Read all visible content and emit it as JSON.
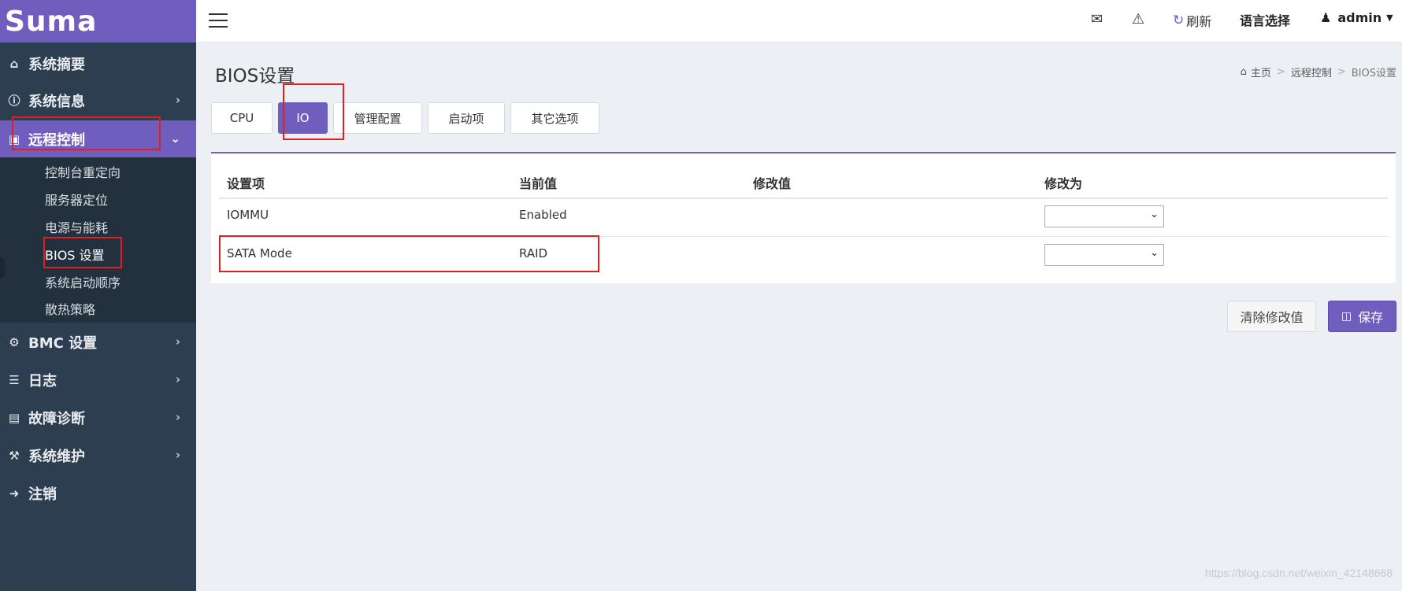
{
  "brand": {
    "logo_text": "Suma",
    "accent_color": "#6f5ebd"
  },
  "sidebar": {
    "items": [
      {
        "label": "系统摘要",
        "icon": "home-icon"
      },
      {
        "label": "系统信息",
        "icon": "info-circle-icon"
      },
      {
        "label": "远程控制",
        "icon": "monitor-icon"
      },
      {
        "label": "BMC 设置",
        "icon": "gear-icon"
      },
      {
        "label": "日志",
        "icon": "database-icon"
      },
      {
        "label": "故障诊断",
        "icon": "bar-chart-icon"
      },
      {
        "label": "系统维护",
        "icon": "wrench-icon"
      },
      {
        "label": "注销",
        "icon": "sign-out-icon"
      }
    ],
    "submenu": [
      "控制台重定向",
      "服务器定位",
      "电源与能耗",
      "BIOS 设置",
      "系统启动顺序",
      "散热策略"
    ]
  },
  "topbar": {
    "refresh_label": "刷新",
    "language_label": "语言选择",
    "user_label": "admin"
  },
  "page": {
    "title": "BIOS设置",
    "breadcrumb": [
      "主页",
      "远程控制",
      "BIOS设置"
    ]
  },
  "tabs": [
    "CPU",
    "IO",
    "管理配置",
    "启动项",
    "其它选项"
  ],
  "table": {
    "headers": [
      "设置项",
      "当前值",
      "修改值",
      "修改为"
    ],
    "rows": [
      {
        "item": "IOMMU",
        "current": "Enabled",
        "modified": ""
      },
      {
        "item": "SATA Mode",
        "current": "RAID",
        "modified": ""
      }
    ]
  },
  "actions": {
    "clear_label": "清除修改值",
    "save_label": "保存"
  },
  "watermark": "https://blog.csdn.net/weixin_42148668"
}
